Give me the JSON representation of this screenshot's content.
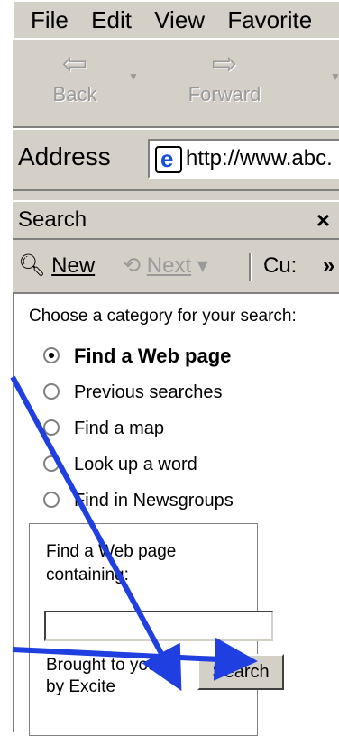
{
  "menu": {
    "file": "File",
    "edit": "Edit",
    "view": "View",
    "favorites": "Favorite"
  },
  "toolbar": {
    "back_label": "Back",
    "forward_label": "Forward"
  },
  "address": {
    "label": "Address",
    "value": "http://www.abc."
  },
  "search_panel": {
    "title": "Search",
    "close": "×",
    "new_label": "New",
    "next_label": "Next",
    "cu_label": "Cu:",
    "more": "»"
  },
  "search_pane": {
    "choose_label": "Choose a category for your search:",
    "options": [
      {
        "label": "Find a Web page",
        "selected": true
      },
      {
        "label": "Previous searches",
        "selected": false
      },
      {
        "label": "Find a map",
        "selected": false
      },
      {
        "label": "Look up a word",
        "selected": false
      },
      {
        "label": "Find in Newsgroups",
        "selected": false
      }
    ],
    "box": {
      "heading_line1": "Find a Web page",
      "heading_line2": "containing:",
      "input_value": "",
      "brought_line1": "Brought to you",
      "brought_line2": "by Excite",
      "search_button": "Search"
    }
  },
  "colors": {
    "chrome": "#d4d0c8",
    "arrow": "#1f3fe0"
  },
  "icons": [
    "back-arrow-icon",
    "forward-arrow-icon",
    "ie-page-icon",
    "close-icon",
    "new-search-icon",
    "next-icon",
    "chevron-more-icon"
  ]
}
